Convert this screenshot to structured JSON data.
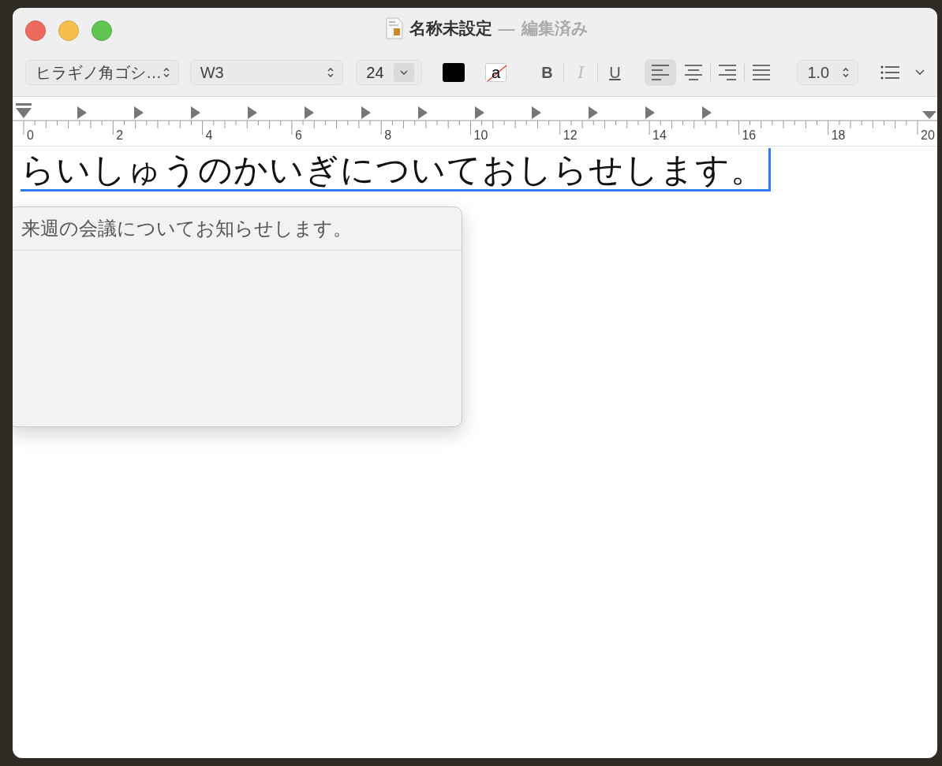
{
  "window": {
    "title": "名称未設定",
    "separator": "—",
    "status": "編集済み"
  },
  "toolbar": {
    "font_family": "ヒラギノ角ゴシ…",
    "font_style": "W3",
    "font_size": "24",
    "background_swatch": "a",
    "style_buttons": [
      {
        "kind": "bold",
        "label": "B",
        "disabled": false
      },
      {
        "kind": "italic",
        "label": "I",
        "disabled": true
      },
      {
        "kind": "underline",
        "label": "U",
        "disabled": false
      }
    ],
    "alignment": [
      {
        "kind": "left",
        "selected": true
      },
      {
        "kind": "center",
        "selected": false
      },
      {
        "kind": "right",
        "selected": false
      },
      {
        "kind": "justify",
        "selected": false
      }
    ],
    "line_spacing": "1.0"
  },
  "ruler": {
    "labels": [
      "0",
      "2",
      "4",
      "6",
      "8",
      "10",
      "12",
      "14",
      "16",
      "18",
      "20"
    ]
  },
  "document": {
    "composing_text": "らいしゅうのかいぎについておしらせします。"
  },
  "candidates": [
    "来週の会議についてお知らせします。"
  ]
}
